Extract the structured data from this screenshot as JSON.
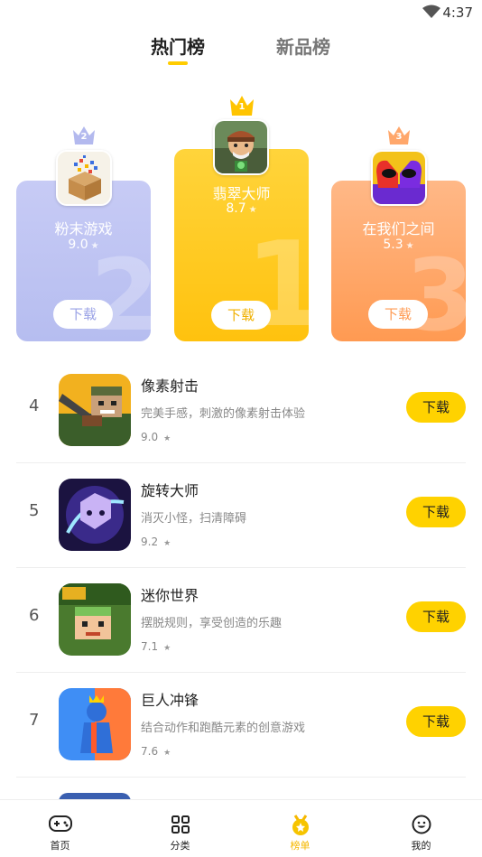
{
  "status": {
    "time": "4:37"
  },
  "tabs": {
    "hot": "热门榜",
    "new": "新品榜"
  },
  "podium": [
    {
      "rank": "1",
      "big": "1",
      "name": "翡翠大师",
      "rating": "8.7",
      "button": "下载"
    },
    {
      "rank": "2",
      "big": "2",
      "name": "粉末游戏",
      "rating": "9.0",
      "button": "下载"
    },
    {
      "rank": "3",
      "big": "3",
      "name": "在我们之间",
      "rating": "5.3",
      "button": "下载"
    }
  ],
  "list": [
    {
      "rank": "4",
      "title": "像素射击",
      "desc": "完美手感，刺激的像素射击体验",
      "score": "9.0",
      "button": "下载"
    },
    {
      "rank": "5",
      "title": "旋转大师",
      "desc": "消灭小怪，扫清障碍",
      "score": "9.2",
      "button": "下载"
    },
    {
      "rank": "6",
      "title": "迷你世界",
      "desc": "摆脱规则，享受创造的乐趣",
      "score": "7.1",
      "button": "下载"
    },
    {
      "rank": "7",
      "title": "巨人冲锋",
      "desc": "结合动作和跑酷元素的创意游戏",
      "score": "7.6",
      "button": "下载"
    }
  ],
  "nav": {
    "home": "首页",
    "category": "分类",
    "ranking": "榜单",
    "mine": "我的"
  },
  "icons": {
    "wifi": "wifi-icon",
    "star": "star-icon",
    "crown": "crown-icon",
    "home": "gamepad-icon",
    "category": "grid-icon",
    "ranking": "medal-icon",
    "mine": "smiley-icon"
  },
  "colors": {
    "accent": "#ffd200",
    "gold_card": "#ffcc1a",
    "silver_card": "#c3c8f3",
    "bronze_card": "#ffa76b"
  }
}
